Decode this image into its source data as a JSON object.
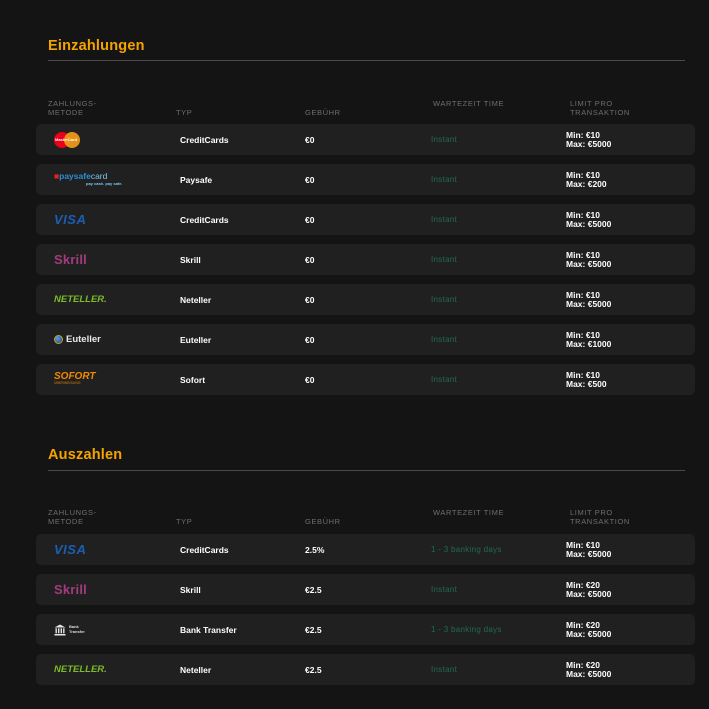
{
  "headers": {
    "method": "ZAHLUNGS-\nMETODE",
    "type": "TYP",
    "fee": "GEBÜHR",
    "wait": "WARTEZEIT TIME",
    "limit": "LIMIT PRO\nTRANSAKTION"
  },
  "logos": {
    "mastercard": {
      "text": "MasterCard"
    },
    "paysafecard": {
      "main": "paysafe",
      "card": "card",
      "sub": "pay cash. pay safe."
    },
    "visa": {
      "text": "VISA"
    },
    "skrill": {
      "text": "Skrill"
    },
    "neteller": {
      "text": "NETELLER."
    },
    "euteller": {
      "text": "Euteller"
    },
    "sofort": {
      "main": "SOFORT",
      "sub": "ÜBERWEISUNG"
    },
    "bank": {
      "line1": "Bank",
      "line2": "Transfer"
    }
  },
  "deposits": {
    "title": "Einzahlungen",
    "rows": [
      {
        "type": "CreditCards",
        "fee": "€0",
        "wait": "Instant",
        "min": "Min: €10",
        "max": "Max: €5000"
      },
      {
        "type": "Paysafe",
        "fee": "€0",
        "wait": "Instant",
        "min": "Min: €10",
        "max": "Max: €200"
      },
      {
        "type": "CreditCards",
        "fee": "€0",
        "wait": "Instant",
        "min": "Min: €10",
        "max": "Max: €5000"
      },
      {
        "type": "Skrill",
        "fee": "€0",
        "wait": "Instant",
        "min": "Min: €10",
        "max": "Max: €5000"
      },
      {
        "type": "Neteller",
        "fee": "€0",
        "wait": "Instant",
        "min": "Min: €10",
        "max": "Max: €5000"
      },
      {
        "type": "Euteller",
        "fee": "€0",
        "wait": "Instant",
        "min": "Min: €10",
        "max": "Max: €1000"
      },
      {
        "type": "Sofort",
        "fee": "€0",
        "wait": "Instant",
        "min": "Min: €10",
        "max": "Max: €500"
      }
    ]
  },
  "withdrawals": {
    "title": "Auszahlen",
    "rows": [
      {
        "type": "CreditCards",
        "fee": "2.5%",
        "wait": "1 - 3 banking days",
        "min": "Min: €10",
        "max": "Max: €5000"
      },
      {
        "type": "Skrill",
        "fee": "€2.5",
        "wait": "Instant",
        "min": "Min: €20",
        "max": "Max: €5000"
      },
      {
        "type": "Bank Transfer",
        "fee": "€2.5",
        "wait": "1 - 3 banking days",
        "min": "Min: €20",
        "max": "Max: €5000"
      },
      {
        "type": "Neteller",
        "fee": "€2.5",
        "wait": "Instant",
        "min": "Min: €20",
        "max": "Max: €5000"
      }
    ]
  },
  "colors": {
    "background": "#141414",
    "row": "#202020",
    "accent": "#f5a300",
    "wait_text": "#1f6b4f"
  }
}
